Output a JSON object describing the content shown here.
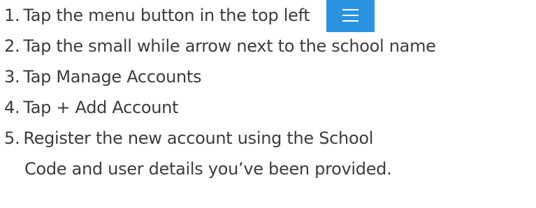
{
  "steps": [
    {
      "number": "1.",
      "text": "Tap the menu button in the top left",
      "icon": "menu-icon",
      "icon_color": "#2a93e0"
    },
    {
      "number": "2.",
      "text": "Tap the small while arrow next to the school name"
    },
    {
      "number": "3.",
      "text": "Tap Manage Accounts"
    },
    {
      "number": "4.",
      "text": "Tap + Add Account"
    },
    {
      "number": "5.",
      "text": "Register the new account using the School",
      "continuation": "Code and user details you’ve been provided."
    }
  ],
  "colors": {
    "text": "#3c3c3c",
    "accent": "#2a93e0",
    "background": "#ffffff"
  }
}
